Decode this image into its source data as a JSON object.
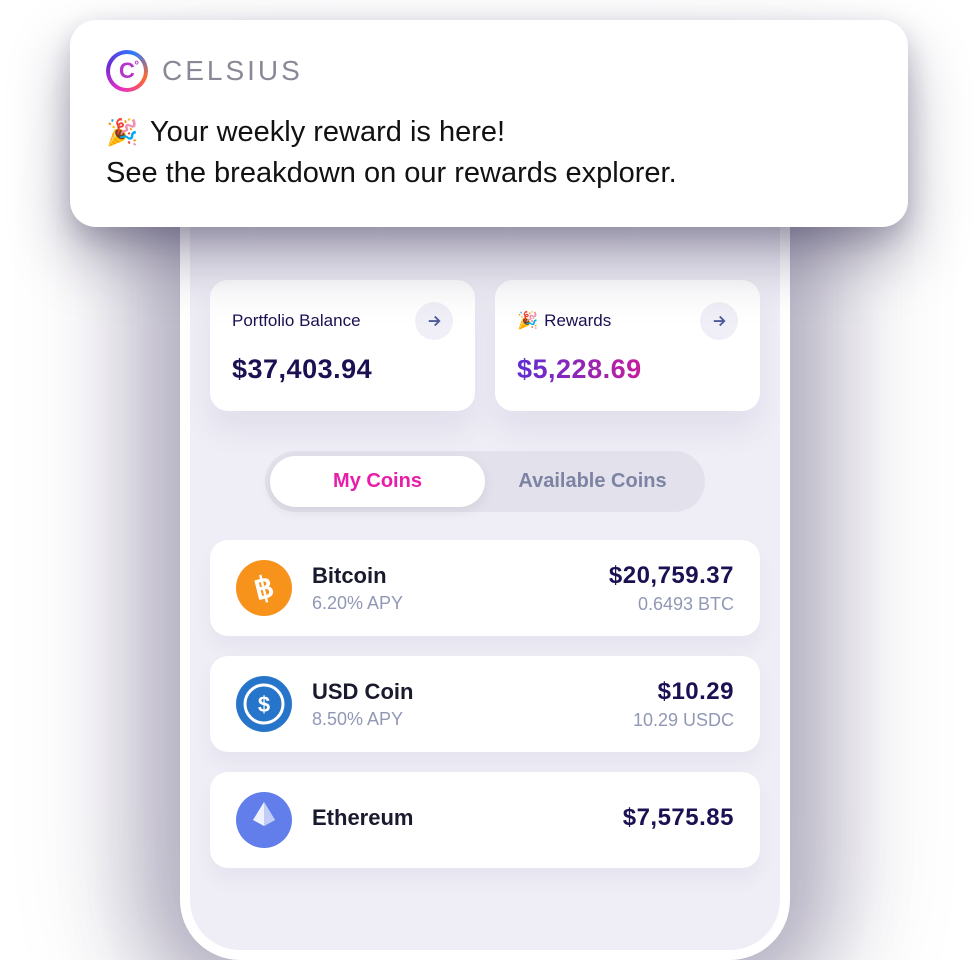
{
  "notification": {
    "brand": "CELSIUS",
    "headline_emoji": "🎉",
    "headline": "Your weekly reward is here!",
    "subline": "See the breakdown on our rewards explorer."
  },
  "summary": {
    "portfolio": {
      "label": "Portfolio Balance",
      "value": "$37,403.94"
    },
    "rewards": {
      "label": "Rewards",
      "emoji": "🎉",
      "value": "$5,228.69"
    }
  },
  "tabs": {
    "active": "My Coins",
    "inactive": "Available Coins"
  },
  "coins": [
    {
      "name": "Bitcoin",
      "apy": "6.20% APY",
      "usd": "$20,759.37",
      "amount": "0.6493 BTC",
      "symbol": "btc"
    },
    {
      "name": "USD Coin",
      "apy": "8.50% APY",
      "usd": "$10.29",
      "amount": "10.29 USDC",
      "symbol": "usdc"
    },
    {
      "name": "Ethereum",
      "apy": "",
      "usd": "$7,575.85",
      "amount": "",
      "symbol": "eth"
    }
  ]
}
